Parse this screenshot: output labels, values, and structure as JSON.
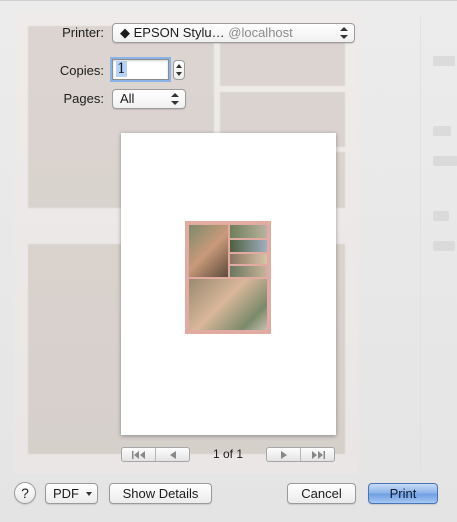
{
  "dialog": {
    "printer_label": "Printer:",
    "printer_name": "◆ EPSON Stylu…",
    "printer_host": "@localhost",
    "copies_label": "Copies:",
    "copies_value": "1",
    "pages_label": "Pages:",
    "pages_value": "All",
    "page_counter": "1 of 1"
  },
  "footer": {
    "help_label": "?",
    "pdf_label": "PDF",
    "show_details_label": "Show Details",
    "cancel_label": "Cancel",
    "print_label": "Print"
  },
  "colors": {
    "accent": "#6f9fe4",
    "thumbnail_border": "#e2aba2"
  }
}
